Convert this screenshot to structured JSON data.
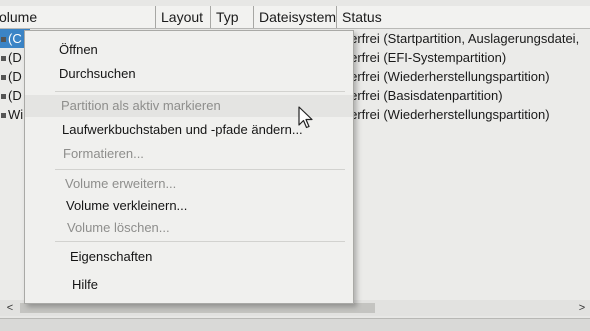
{
  "table": {
    "columns": [
      "olume",
      "Layout",
      "Typ",
      "Dateisystem",
      "Status"
    ],
    "rows": [
      {
        "volume": "(C",
        "status": "hlerfrei (Startpartition, Auslagerungsdatei,",
        "selected": true
      },
      {
        "volume": "(D",
        "status": "hlerfrei (EFI-Systempartition)",
        "selected": false
      },
      {
        "volume": "(D",
        "status": "hlerfrei (Wiederherstellungspartition)",
        "selected": false
      },
      {
        "volume": "(D",
        "status": "hlerfrei (Basisdatenpartition)",
        "selected": false
      },
      {
        "volume": "Wi",
        "status": "hlerfrei (Wiederherstellungspartition)",
        "selected": false
      }
    ]
  },
  "context_menu": {
    "items": [
      {
        "label": "Öffnen",
        "enabled": true
      },
      {
        "label": "Durchsuchen",
        "enabled": true
      },
      {
        "label": "Partition als aktiv markieren",
        "enabled": false
      },
      {
        "label": "Laufwerkbuchstaben und -pfade ändern...",
        "enabled": true
      },
      {
        "label": "Formatieren...",
        "enabled": false
      },
      {
        "label": "Volume erweitern...",
        "enabled": false
      },
      {
        "label": "Volume verkleinern...",
        "enabled": true
      },
      {
        "label": "Volume löschen...",
        "enabled": false
      },
      {
        "label": "Eigenschaften",
        "enabled": true
      },
      {
        "label": "Hilfe",
        "enabled": true
      }
    ]
  },
  "scrollbar": {
    "left_arrow": "<",
    "right_arrow": ">"
  }
}
